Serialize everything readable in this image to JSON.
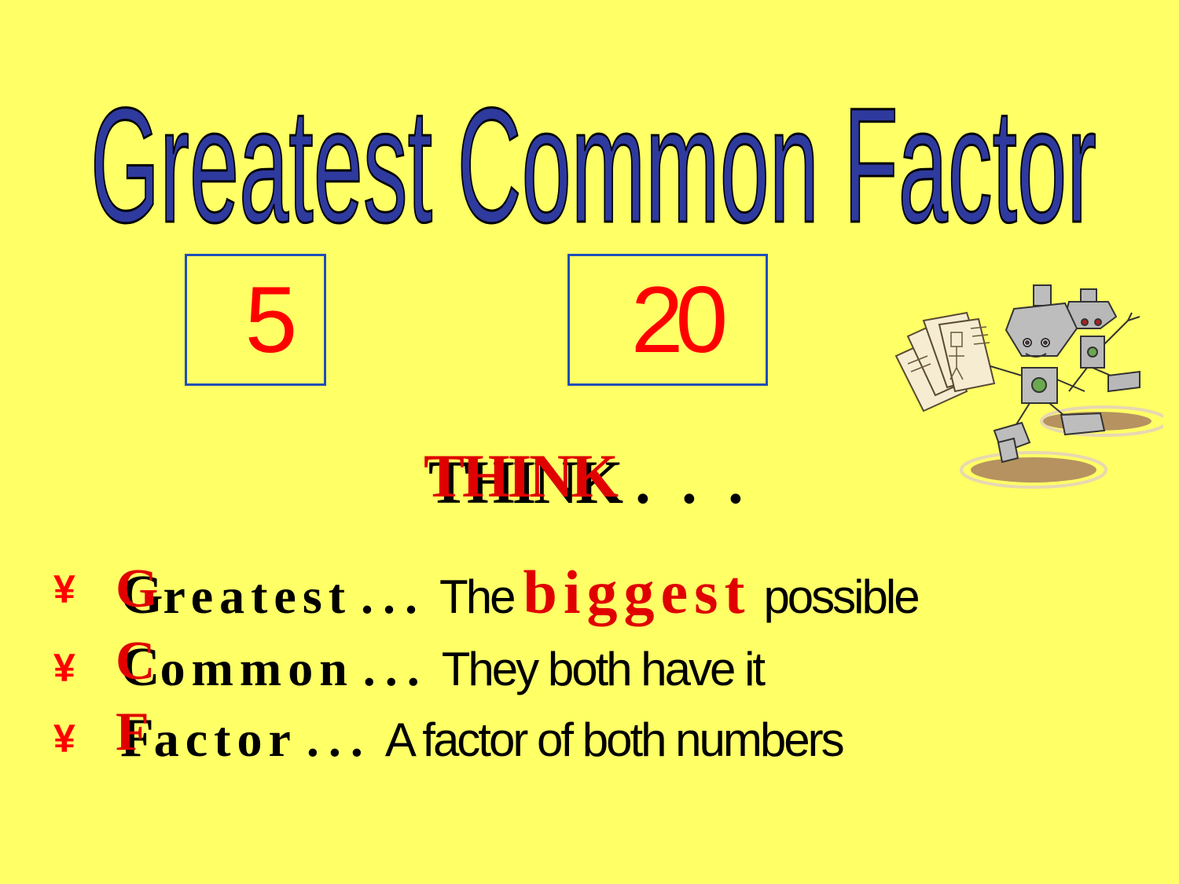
{
  "title": "Greatest  Common  Factor",
  "numbers": {
    "first": "5",
    "second": "20"
  },
  "think": {
    "word": "THINK",
    "dots": ". . ."
  },
  "bullet_symbol": "¥",
  "items": [
    {
      "initial": "G",
      "rest": "reatest",
      "ellipsis": "...",
      "phrase_before": "The",
      "highlight": "biggest",
      "phrase_after": "possible"
    },
    {
      "initial": "C",
      "rest": "ommon",
      "ellipsis": "...",
      "phrase_before": "They both have it",
      "highlight": "",
      "phrase_after": ""
    },
    {
      "initial": "F",
      "rest": "actor",
      "ellipsis": "...",
      "phrase_before": "A factor of both numbers",
      "highlight": "",
      "phrase_after": ""
    }
  ],
  "colors": {
    "background": "#ffff66",
    "title_fill": "#2e3a9e",
    "number_red": "#ff0000",
    "box_border": "#1f4fb8",
    "accent_red": "#e00000"
  },
  "icons": [
    "robots-clipart"
  ]
}
